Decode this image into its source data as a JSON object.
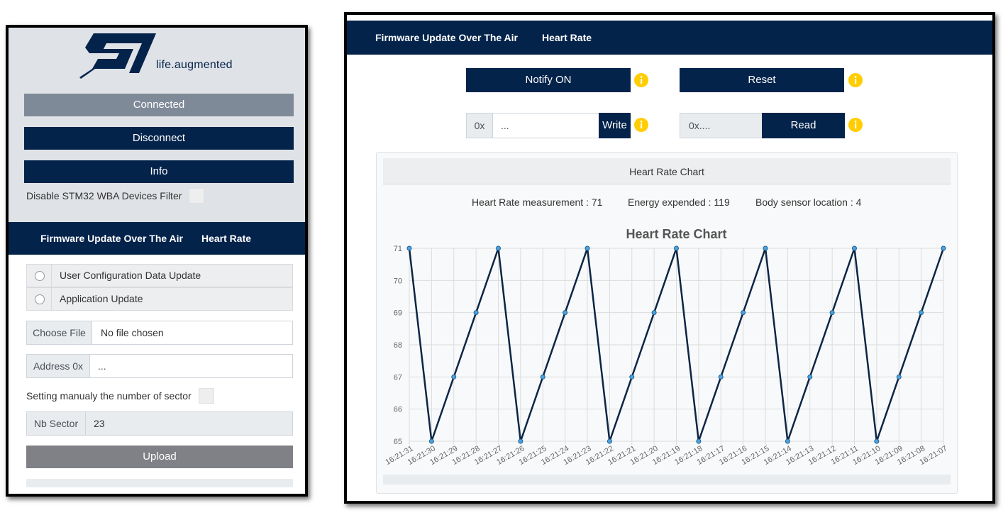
{
  "left": {
    "logo_tagline": "life.augmented",
    "buttons": {
      "connected": "Connected",
      "disconnect": "Disconnect",
      "info": "Info"
    },
    "filter_label": "Disable STM32 WBA Devices Filter",
    "nav": {
      "item1": "Firmware Update Over The Air",
      "item2": "Heart Rate"
    },
    "radio_options": [
      "User Configuration Data Update",
      "Application Update"
    ],
    "choose_file": {
      "button": "Choose File",
      "value": "No file chosen"
    },
    "address": {
      "prefix": "Address 0x",
      "placeholder": "..."
    },
    "sector_manual_label": "Setting manualy the number of sector",
    "nb_sector": {
      "prefix": "Nb Sector",
      "value": "23"
    },
    "upload_label": "Upload",
    "upload_progress": 0
  },
  "right": {
    "nav": {
      "item1": "Firmware Update Over The Air",
      "item2": "Heart Rate"
    },
    "notify_label": "Notify ON",
    "reset_label": "Reset",
    "write": {
      "prefix": "0x",
      "placeholder": "...",
      "button": "Write"
    },
    "read": {
      "value": "0x....",
      "button": "Read"
    },
    "card_header": "Heart Rate Chart",
    "measurements": {
      "heart_rate": "Heart Rate measurement : 71",
      "energy": "Energy expended : 119",
      "body_sensor": "Body sensor location : 4"
    }
  },
  "colors": {
    "navy": "#03234b",
    "line": "#0b2545",
    "marker": "#4aa3df",
    "info_icon": "#ffcd00",
    "connected_bg": "#7f8a99",
    "upload_bg": "#7f8186"
  },
  "chart_data": {
    "type": "line",
    "title": "Heart Rate Chart",
    "xlabel": "",
    "ylabel": "",
    "ylim": [
      65,
      71
    ],
    "yticks": [
      65,
      66,
      67,
      68,
      69,
      70,
      71
    ],
    "grid": true,
    "categories": [
      "16:21:31",
      "16:21:30",
      "16:21:29",
      "16:21:28",
      "16:21:27",
      "16:21:26",
      "16:21:25",
      "16:21:24",
      "16:21:23",
      "16:21:22",
      "16:21:21",
      "16:21:20",
      "16:21:19",
      "16:21:18",
      "16:21:17",
      "16:21:16",
      "16:21:15",
      "16:21:14",
      "16:21:13",
      "16:21:12",
      "16:21:11",
      "16:21:10",
      "16:21:09",
      "16:21:08",
      "16:21:07"
    ],
    "series": [
      {
        "values": [
          71,
          65,
          67,
          69,
          71,
          65,
          67,
          69,
          71,
          65,
          67,
          69,
          71,
          65,
          67,
          69,
          71,
          65,
          67,
          69,
          71,
          65,
          67,
          69,
          71
        ]
      }
    ]
  }
}
